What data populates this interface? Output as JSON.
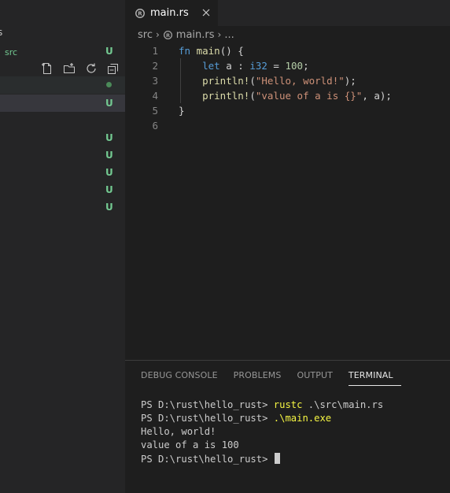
{
  "sidebar": {
    "edge_glyph": "s",
    "folder": "src",
    "badges": [
      {
        "text": "U",
        "row": "src"
      },
      {
        "text": "U",
        "row": "selected"
      },
      {
        "text": "U",
        "row": "r1"
      },
      {
        "text": "U",
        "row": "r2"
      },
      {
        "text": "U",
        "row": "r3"
      },
      {
        "text": "U",
        "row": "r4"
      },
      {
        "text": "U",
        "row": "r5"
      }
    ],
    "actions": [
      "new-file-icon",
      "new-folder-icon",
      "refresh-icon",
      "collapse-all-icon"
    ]
  },
  "tab": {
    "label": "main.rs",
    "icon": "rust-icon",
    "close_icon": "close-icon"
  },
  "breadcrumb": {
    "folder": "src",
    "file": "main.rs",
    "more": "..."
  },
  "editor": {
    "line_numbers": [
      "1",
      "2",
      "3",
      "4",
      "5",
      "6"
    ],
    "lines": [
      [
        {
          "t": "fn",
          "c": "kw"
        },
        {
          "t": " ",
          "c": "plain"
        },
        {
          "t": "main",
          "c": "fn"
        },
        {
          "t": "() {",
          "c": "plain"
        }
      ],
      [
        {
          "t": "    ",
          "c": "plain"
        },
        {
          "t": "let",
          "c": "kw"
        },
        {
          "t": " a : ",
          "c": "plain"
        },
        {
          "t": "i32",
          "c": "kw"
        },
        {
          "t": " = ",
          "c": "plain"
        },
        {
          "t": "100",
          "c": "num"
        },
        {
          "t": ";",
          "c": "plain"
        }
      ],
      [
        {
          "t": "    ",
          "c": "plain"
        },
        {
          "t": "println!",
          "c": "fn"
        },
        {
          "t": "(",
          "c": "plain"
        },
        {
          "t": "\"Hello, world!\"",
          "c": "str"
        },
        {
          "t": ");",
          "c": "plain"
        }
      ],
      [
        {
          "t": "    ",
          "c": "plain"
        },
        {
          "t": "println!",
          "c": "fn"
        },
        {
          "t": "(",
          "c": "plain"
        },
        {
          "t": "\"value of a is {}\"",
          "c": "str"
        },
        {
          "t": ", a);",
          "c": "plain"
        }
      ],
      [
        {
          "t": "}",
          "c": "plain"
        }
      ],
      []
    ]
  },
  "panel": {
    "tabs": [
      "DEBUG CONSOLE",
      "PROBLEMS",
      "OUTPUT",
      "TERMINAL"
    ],
    "active_tab": "TERMINAL",
    "terminal": {
      "lines": [
        {
          "prompt": "PS D:\\rust\\hello_rust> ",
          "cmd": "rustc",
          "rest": " .\\src\\main.rs"
        },
        {
          "prompt": "PS D:\\rust\\hello_rust> ",
          "cmd": ".\\main.exe",
          "rest": ""
        },
        {
          "prompt": "",
          "cmd": "",
          "rest": "Hello, world!"
        },
        {
          "prompt": "",
          "cmd": "",
          "rest": "value of a is 100"
        },
        {
          "prompt": "PS D:\\rust\\hello_rust> ",
          "cmd": "",
          "rest": "",
          "cursor": true
        }
      ]
    }
  },
  "colors": {
    "untracked": "#73c991",
    "keyword": "#569cd6",
    "function": "#dcdcaa",
    "string": "#ce9178",
    "number": "#b5cea8",
    "terminal_command": "#f5f543"
  }
}
